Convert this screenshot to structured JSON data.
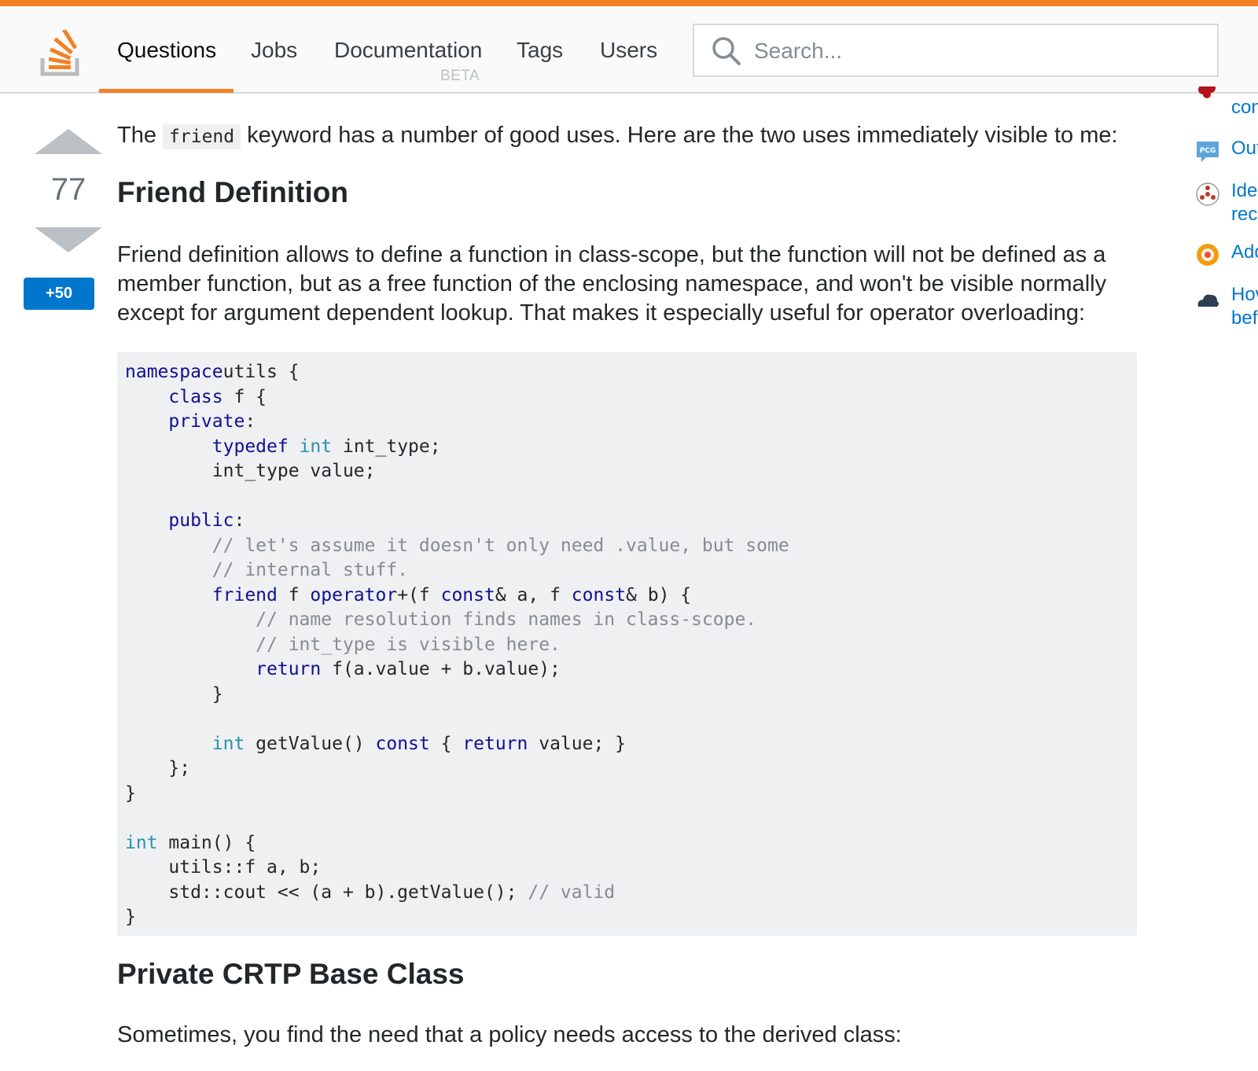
{
  "header": {
    "nav": [
      {
        "label": "Questions",
        "active": true
      },
      {
        "label": "Jobs"
      },
      {
        "label": "Documentation",
        "badge": "BETA"
      },
      {
        "label": "Tags"
      },
      {
        "label": "Users"
      }
    ],
    "search_placeholder": "Search...",
    "accent_color": "#f48024"
  },
  "vote": {
    "count": "77",
    "bounty": "+50"
  },
  "post": {
    "intro_before": "The ",
    "intro_code": "friend",
    "intro_after": " keyword has a number of good uses. Here are the two uses immediately visible to me:",
    "h1": "Friend Definition",
    "p2": "Friend definition allows to define a function in class-scope, but the function will not be defined as a member function, but as a free function of the enclosing namespace, and won't be visible normally except for argument dependent lookup. That makes it especially useful for operator overloading:",
    "code": [
      [
        [
          "kw",
          "namespace"
        ],
        [
          "",
          "utils {"
        ]
      ],
      [
        [
          "",
          "    "
        ],
        [
          "kw",
          "class"
        ],
        [
          "",
          " f {"
        ]
      ],
      [
        [
          "",
          "    "
        ],
        [
          "kw",
          "private"
        ],
        [
          "",
          ":"
        ]
      ],
      [
        [
          "",
          "        "
        ],
        [
          "kw",
          "typedef"
        ],
        [
          "",
          " "
        ],
        [
          "ty",
          "int"
        ],
        [
          "",
          " int_type;"
        ]
      ],
      [
        [
          "",
          "        int_type value;"
        ]
      ],
      [
        [
          "",
          ""
        ]
      ],
      [
        [
          "",
          "    "
        ],
        [
          "kw",
          "public"
        ],
        [
          "",
          ":"
        ]
      ],
      [
        [
          "",
          "        "
        ],
        [
          "cm",
          "// let's assume it doesn't only need .value, but some"
        ]
      ],
      [
        [
          "",
          "        "
        ],
        [
          "cm",
          "// internal stuff."
        ]
      ],
      [
        [
          "",
          "        "
        ],
        [
          "kw",
          "friend"
        ],
        [
          "",
          " f "
        ],
        [
          "kw",
          "operator"
        ],
        [
          "",
          "+(f "
        ],
        [
          "kw",
          "const"
        ],
        [
          "",
          "& a, f "
        ],
        [
          "kw",
          "const"
        ],
        [
          "",
          "& b) {"
        ]
      ],
      [
        [
          "",
          "            "
        ],
        [
          "cm",
          "// name resolution finds names in class-scope."
        ]
      ],
      [
        [
          "",
          "            "
        ],
        [
          "cm",
          "// int_type is visible here."
        ]
      ],
      [
        [
          "",
          "            "
        ],
        [
          "kw",
          "return"
        ],
        [
          "",
          " f(a.value + b.value);"
        ]
      ],
      [
        [
          "",
          "        }"
        ]
      ],
      [
        [
          "",
          ""
        ]
      ],
      [
        [
          "",
          "        "
        ],
        [
          "ty",
          "int"
        ],
        [
          "",
          " getValue() "
        ],
        [
          "kw",
          "const"
        ],
        [
          "",
          " { "
        ],
        [
          "kw",
          "return"
        ],
        [
          "",
          " value; }"
        ]
      ],
      [
        [
          "",
          "    };"
        ]
      ],
      [
        [
          "",
          "}"
        ]
      ],
      [
        [
          "",
          ""
        ]
      ],
      [
        [
          "ty",
          "int"
        ],
        [
          "",
          " main() {"
        ]
      ],
      [
        [
          "",
          "    utils::f a, b;"
        ]
      ],
      [
        [
          "",
          "    std::cout << (a + b).getValue(); "
        ],
        [
          "cm",
          "// valid"
        ]
      ],
      [
        [
          "",
          "}"
        ]
      ]
    ],
    "h2": "Private CRTP Base Class",
    "p3": "Sometimes, you find the need that a policy needs access to the derived class:"
  },
  "sidebar": {
    "items": [
      {
        "icon": "gem-icon",
        "lines": [
          "con"
        ]
      },
      {
        "icon": "pcg-chat-icon",
        "lines": [
          "Out"
        ]
      },
      {
        "icon": "red-emblem-icon",
        "lines": [
          "Ide",
          "rec"
        ]
      },
      {
        "icon": "orange-sun-icon",
        "lines": [
          "Adc"
        ]
      },
      {
        "icon": "cloud-network-icon",
        "lines": [
          "Hov",
          "bef"
        ]
      }
    ]
  }
}
